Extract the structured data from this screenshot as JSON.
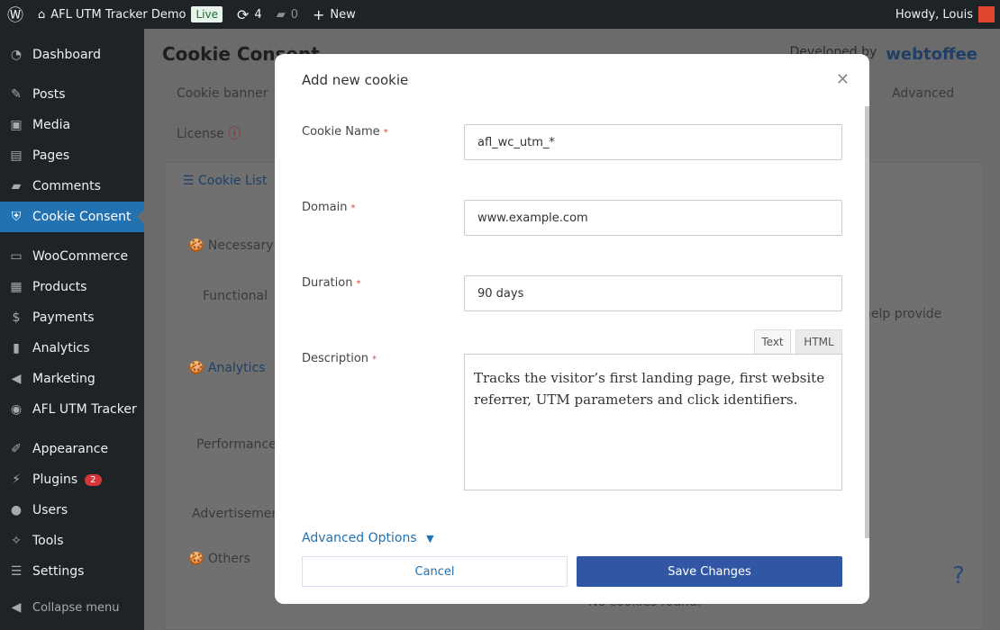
{
  "adminbar": {
    "site": "AFL UTM Tracker Demo",
    "live": "Live",
    "updates": "4",
    "comments": "0",
    "new": "New",
    "howdy": "Howdy, Louis"
  },
  "sidebar": {
    "items": [
      {
        "label": "Dashboard",
        "icon": "dashboard-icon",
        "glyph": "◔"
      },
      {
        "label": "Posts",
        "icon": "pin-icon",
        "glyph": "✎"
      },
      {
        "label": "Media",
        "icon": "media-icon",
        "glyph": "▣"
      },
      {
        "label": "Pages",
        "icon": "pages-icon",
        "glyph": "▤"
      },
      {
        "label": "Comments",
        "icon": "comment-icon",
        "glyph": "▰"
      },
      {
        "label": "Cookie Consent",
        "icon": "shield-icon",
        "glyph": "⛨"
      },
      {
        "label": "WooCommerce",
        "icon": "woo-icon",
        "glyph": "▭"
      },
      {
        "label": "Products",
        "icon": "archive-icon",
        "glyph": "▦"
      },
      {
        "label": "Payments",
        "icon": "dollar-icon",
        "glyph": "$"
      },
      {
        "label": "Analytics",
        "icon": "bar-chart-icon",
        "glyph": "▮"
      },
      {
        "label": "Marketing",
        "icon": "megaphone-icon",
        "glyph": "◀"
      },
      {
        "label": "AFL UTM Tracker",
        "icon": "user-circle-icon",
        "glyph": "◉"
      },
      {
        "label": "Appearance",
        "icon": "brush-icon",
        "glyph": "✐"
      },
      {
        "label": "Plugins",
        "icon": "plug-icon",
        "glyph": "⚡",
        "badge": "2"
      },
      {
        "label": "Users",
        "icon": "users-icon",
        "glyph": "●"
      },
      {
        "label": "Tools",
        "icon": "wrench-icon",
        "glyph": "✧"
      },
      {
        "label": "Settings",
        "icon": "sliders-icon",
        "glyph": "☰"
      }
    ],
    "collapse": "Collapse menu"
  },
  "page": {
    "title": "Cookie Consent",
    "developed_by": "Developed by",
    "brand": "webtoffee",
    "tabs": [
      "Cookie banner",
      "Advanced",
      "License"
    ],
    "cookie_list": "Cookie List",
    "categories": [
      "Necessary",
      "Functional",
      "Analytics",
      "Performance",
      "Advertisement",
      "Others"
    ],
    "help_text": "help provide",
    "no_cookies": "No cookies found."
  },
  "modal": {
    "title": "Add new cookie",
    "fields": [
      {
        "label": "Cookie Name",
        "value": "afl_wc_utm_*"
      },
      {
        "label": "Domain",
        "value": "www.example.com"
      },
      {
        "label": "Duration",
        "value": "90 days"
      },
      {
        "label": "Description",
        "value": "Tracks the visitor’s first landing page, first website referrer, UTM parameters and click identifiers."
      }
    ],
    "required": "*",
    "editor_tabs": [
      "Text",
      "HTML"
    ],
    "advanced": "Advanced Options",
    "cancel": "Cancel",
    "save": "Save Changes"
  },
  "help": "?"
}
